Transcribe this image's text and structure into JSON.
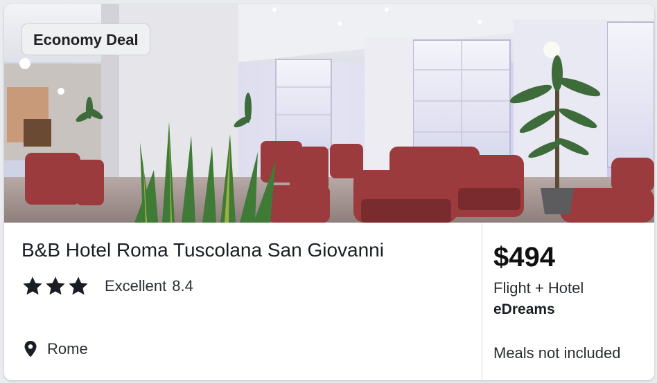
{
  "badge": {
    "label": "Economy Deal"
  },
  "hotel": {
    "name": "B&B Hotel Roma Tuscolana San Giovanni",
    "star_count": 3,
    "rating_text": "Excellent",
    "rating_score": "8.4",
    "location": "Rome"
  },
  "offer": {
    "price": "$494",
    "package": "Flight + Hotel",
    "provider": "eDreams",
    "meals": "Meals not included"
  },
  "icons": {
    "star": "star-icon",
    "location": "map-pin-icon"
  },
  "colors": {
    "text": "#1a1e24",
    "badge_bg": "#eef0f2",
    "divider": "#d4d8dd",
    "star": "#1a1e24"
  }
}
